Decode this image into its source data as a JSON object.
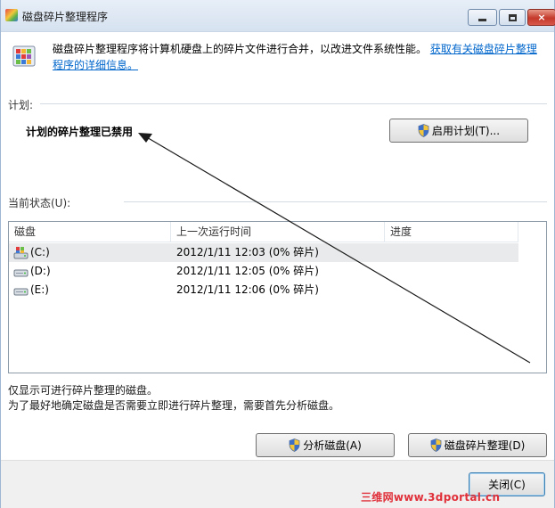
{
  "window": {
    "title": "磁盘碎片整理程序",
    "controls": {
      "minimize": "minimize",
      "maximize": "maximize",
      "close": "×"
    }
  },
  "header": {
    "description": "磁盘碎片整理程序将计算机硬盘上的碎片文件进行合并，以改进文件系统性能。",
    "link_text": "获取有关磁盘碎片整理程序的详细信息。"
  },
  "schedule": {
    "label": "计划:",
    "status": "计划的碎片整理已禁用",
    "enable_button": "启用计划(T)..."
  },
  "current_status": {
    "label": "当前状态(U):",
    "columns": [
      "磁盘",
      "上一次运行时间",
      "进度"
    ],
    "rows": [
      {
        "disk": "(C:)",
        "last_run": "2012/1/11 12:03 (0% 碎片)",
        "progress": "",
        "icon": "system-drive-icon"
      },
      {
        "disk": "(D:)",
        "last_run": "2012/1/11 12:05 (0% 碎片)",
        "progress": "",
        "icon": "drive-icon"
      },
      {
        "disk": "(E:)",
        "last_run": "2012/1/11 12:06 (0% 碎片)",
        "progress": "",
        "icon": "drive-icon"
      }
    ]
  },
  "notes": {
    "line1": "仅显示可进行碎片整理的磁盘。",
    "line2": "为了最好地确定磁盘是否需要立即进行碎片整理，需要首先分析磁盘。"
  },
  "actions": {
    "analyze": "分析磁盘(A)",
    "defragment": "磁盘碎片整理(D)",
    "close": "关闭(C)"
  },
  "watermark": "三维网www.3dportal.cn",
  "colors": {
    "link": "#0066cc",
    "watermark": "#e0303a",
    "accent_border": "#3c7fb1"
  }
}
